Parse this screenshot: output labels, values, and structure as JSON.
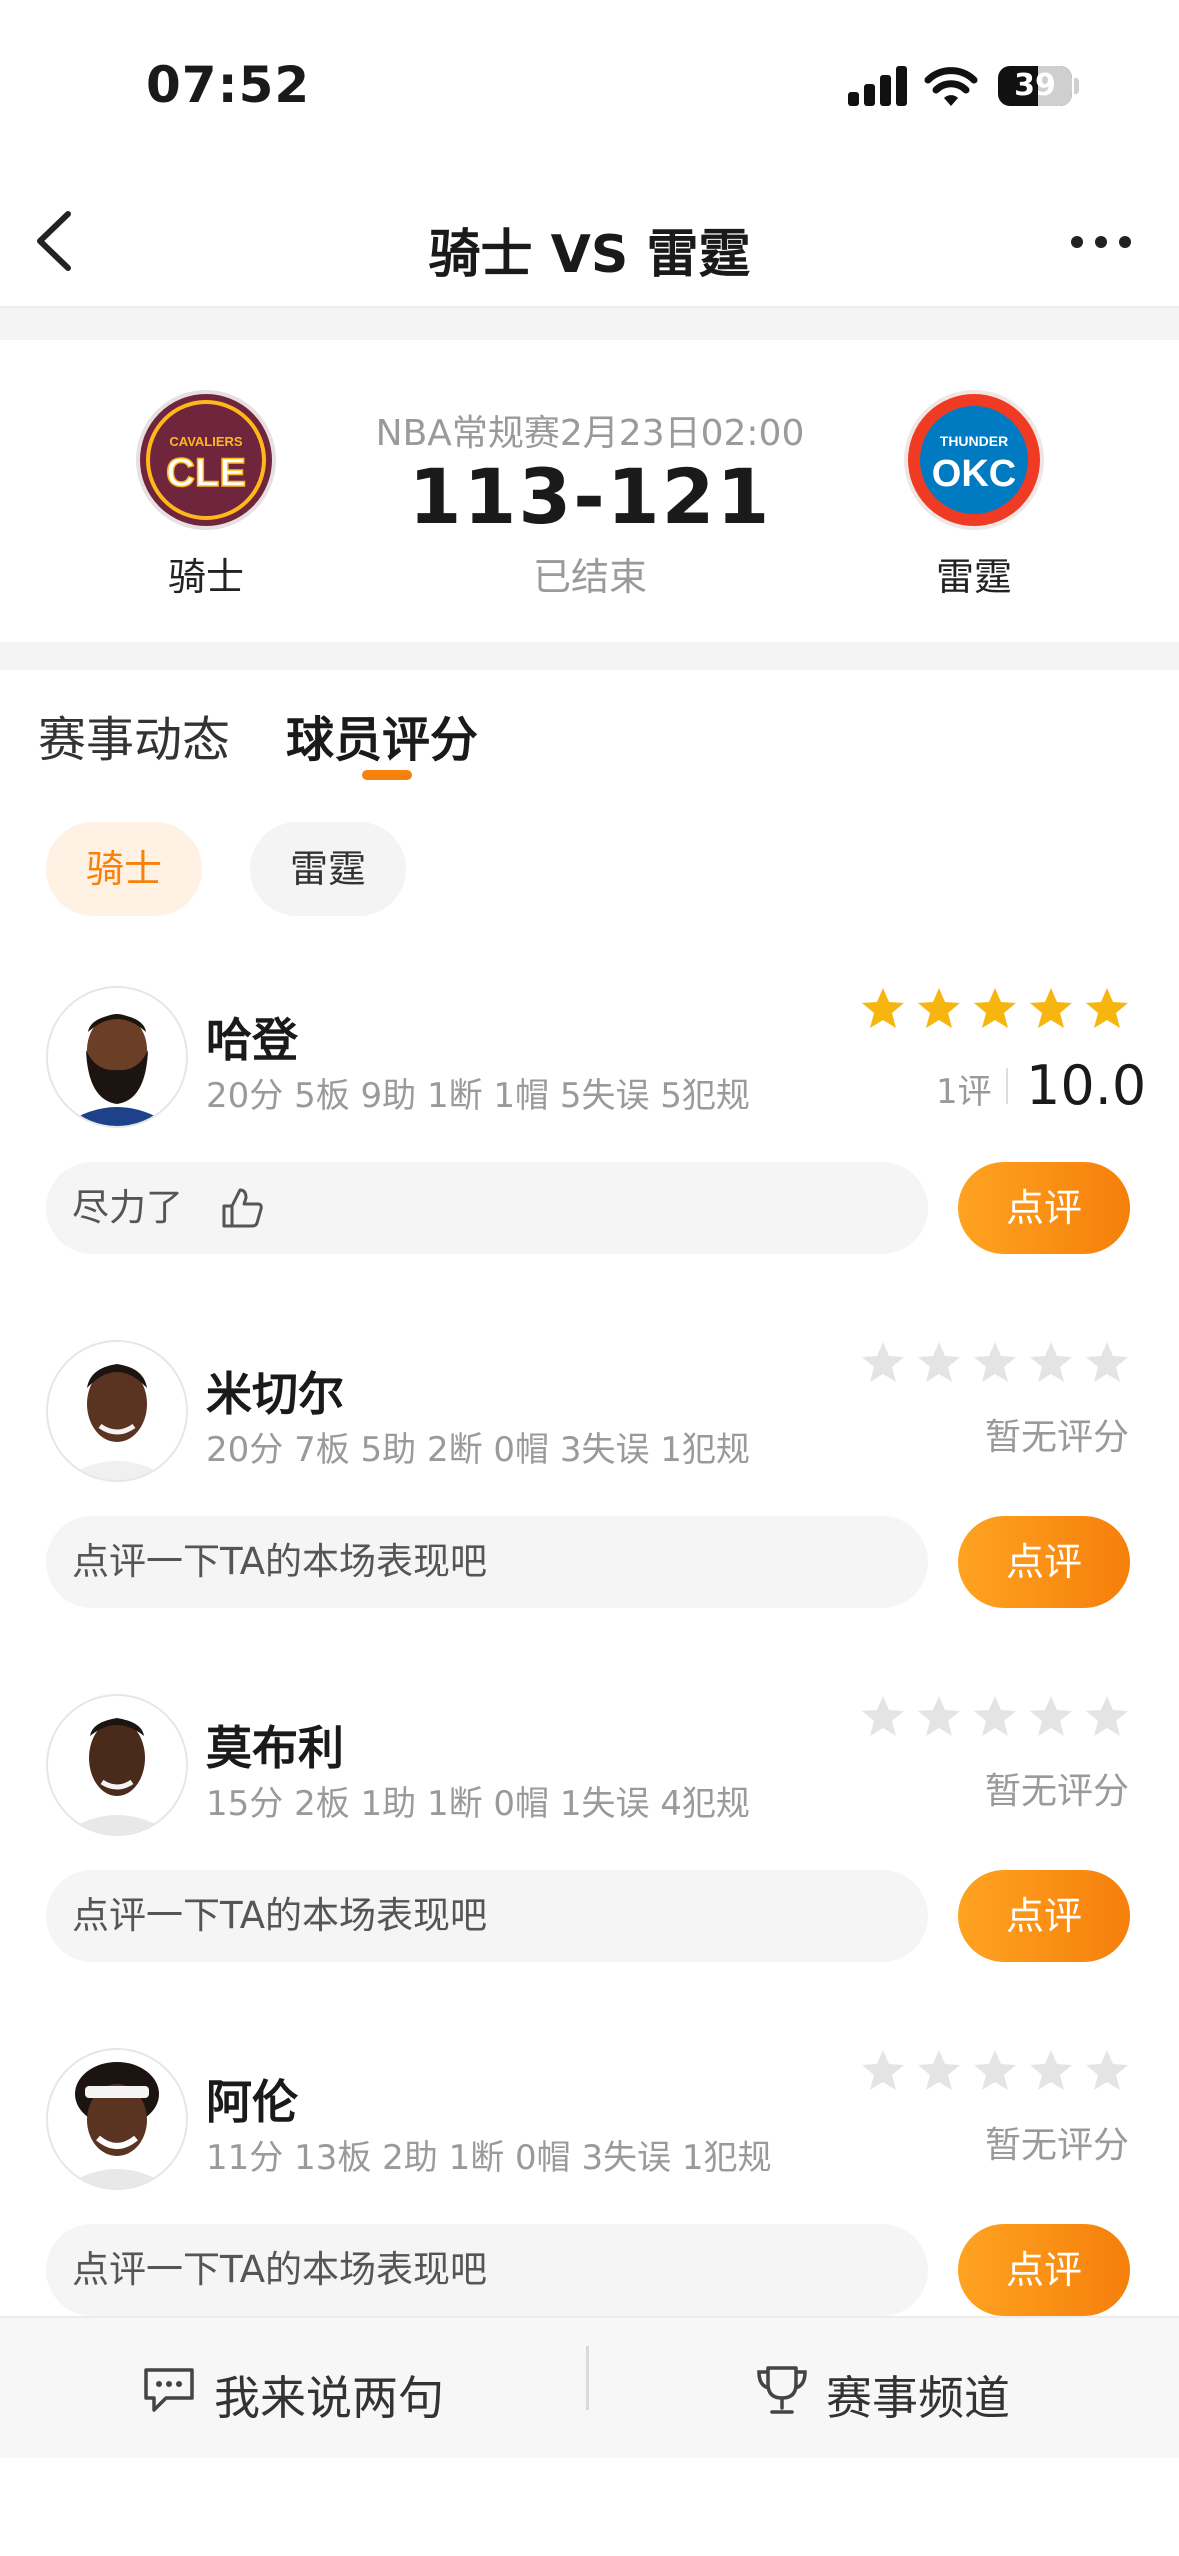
{
  "status_bar": {
    "time": "07:52",
    "battery": "39"
  },
  "nav": {
    "title": "骑士 VS 雷霆"
  },
  "match": {
    "home": {
      "name": "骑士",
      "logo_top": "CAVALIERS",
      "logo_main": "CLE"
    },
    "away": {
      "name": "雷霆",
      "logo_top": "THUNDER",
      "logo_main": "OKC"
    },
    "info": "NBA常规赛2月23日02:00",
    "score": "113-121",
    "status": "已结束"
  },
  "tabs": [
    {
      "label": "赛事动态"
    },
    {
      "label": "球员评分"
    }
  ],
  "team_filter": [
    {
      "label": "骑士"
    },
    {
      "label": "雷霆"
    }
  ],
  "players": [
    {
      "name": "哈登",
      "stats": "20分 5板 9助 1断 1帽 5失误 5犯规",
      "review_count": "1评",
      "score": "10.0",
      "rated": true,
      "stars": 5,
      "comment": "尽力了",
      "button": "点评"
    },
    {
      "name": "米切尔",
      "stats": "20分 7板 5助 2断 0帽 3失误 1犯规",
      "no_rating": "暂无评分",
      "rated": false,
      "stars": 0,
      "comment": "点评一下TA的本场表现吧",
      "button": "点评"
    },
    {
      "name": "莫布利",
      "stats": "15分 2板 1助 1断 0帽 1失误 4犯规",
      "no_rating": "暂无评分",
      "rated": false,
      "stars": 0,
      "comment": "点评一下TA的本场表现吧",
      "button": "点评"
    },
    {
      "name": "阿伦",
      "stats": "11分 13板 2助 1断 0帽 3失误 1犯规",
      "no_rating": "暂无评分",
      "rated": false,
      "stars": 0,
      "comment": "点评一下TA的本场表现吧",
      "button": "点评"
    }
  ],
  "bottom_bar": {
    "comment_label": "我来说两句",
    "channel_label": "赛事频道"
  },
  "colors": {
    "accent": "#f6820d",
    "star_on": "#f7b50f",
    "star_off": "#e4e4e4",
    "cle_wine": "#6f263d",
    "cle_gold": "#ffb81c",
    "okc_blue": "#007ac1",
    "okc_orange": "#ef3b24"
  },
  "icons": [
    "signal-icon",
    "wifi-icon",
    "battery-icon",
    "back-arrow-icon",
    "more-icon",
    "thumbs-up-icon",
    "star-icon",
    "chat-icon",
    "trophy-icon"
  ]
}
